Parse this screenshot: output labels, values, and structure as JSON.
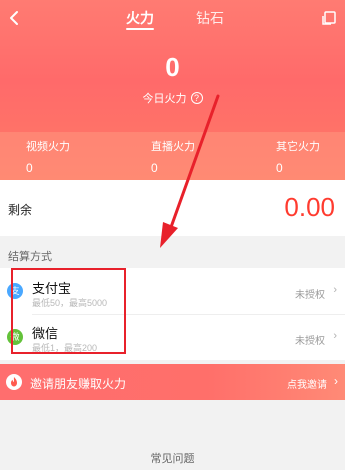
{
  "header": {
    "tabs": [
      {
        "label": "火力"
      },
      {
        "label": "钻石"
      }
    ]
  },
  "summary": {
    "today_value": "0",
    "today_label": "今日火力",
    "help_mark": "?"
  },
  "stats": [
    {
      "label": "视频火力",
      "value": "0"
    },
    {
      "label": "直播火力",
      "value": "0"
    },
    {
      "label": "其它火力",
      "value": "0"
    }
  ],
  "balance": {
    "label": "剩余",
    "amount": "0.00"
  },
  "settlement": {
    "title": "结算方式",
    "methods": [
      {
        "name": "支付宝",
        "limit": "最低50，最高5000",
        "status": "未授权",
        "icon": "alipay-icon",
        "icon_char": "支",
        "color": "#4aa8ff"
      },
      {
        "name": "微信",
        "limit": "最低1，最高200",
        "status": "未授权",
        "icon": "wechat-icon",
        "icon_char": "微",
        "color": "#63c23a"
      }
    ]
  },
  "invite": {
    "label": "邀请朋友赚取火力",
    "action": "点我邀请"
  },
  "footer": {
    "faq": "常见问题"
  },
  "colors": {
    "accent": "#ff6a6a",
    "amount": "#ff3b2f",
    "annotation": "#e8212b"
  }
}
